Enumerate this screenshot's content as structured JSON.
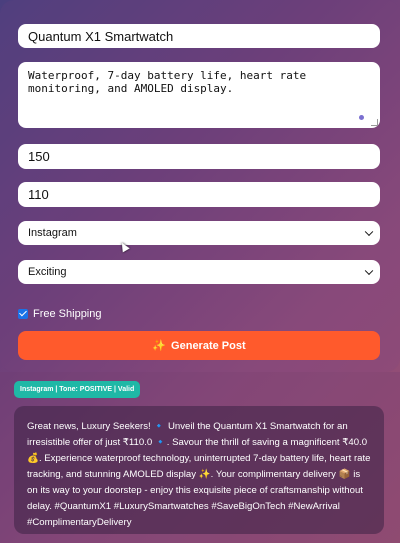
{
  "form": {
    "product_name": "Quantum X1 Smartwatch",
    "description": "Waterproof, 7-day battery life, heart rate monitoring, and AMOLED display.",
    "original_price": "150",
    "sale_price": "110",
    "platform": "Instagram",
    "tone": "Exciting",
    "free_shipping_label": "Free Shipping",
    "free_shipping_checked": true,
    "generate_label": "Generate Post",
    "generate_icon": "✨"
  },
  "result": {
    "badge": "Instagram | Tone: POSITIVE | Valid",
    "post_text": "Great news, Luxury Seekers! 🔹 Unveil the Quantum X1 Smartwatch for an irresistible offer of just ₹110.0 🔹. Savour the thrill of saving a magnificent ₹40.0 💰. Experience waterproof technology, uninterrupted 7-day battery life, heart rate tracking, and stunning AMOLED display ✨. Your complimentary delivery 📦 is on its way to your doorstep - enjoy this exquisite piece of craftsmanship without delay. #QuantumX1 #LuxurySmartwatches #SaveBigOnTech #NewArrival #ComplimentaryDelivery"
  },
  "colors": {
    "accent_button": "#ff5a2c",
    "badge": "#1fb8a6",
    "checkbox": "#1a73e8"
  }
}
